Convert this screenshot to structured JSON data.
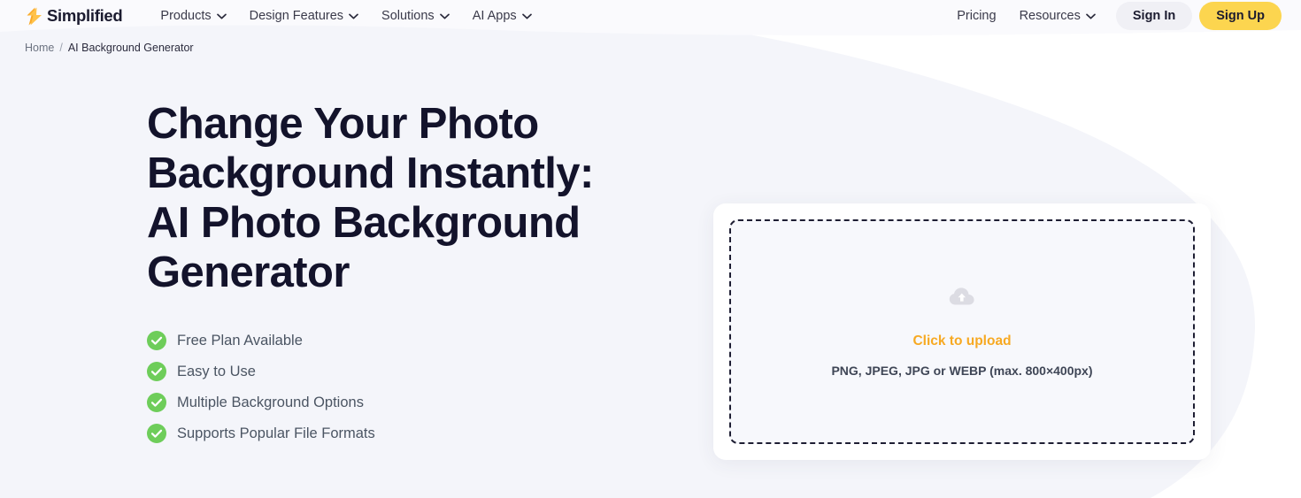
{
  "brand": {
    "name": "Simplified",
    "logo_icon": "simplified-bolt-logo"
  },
  "nav": {
    "left_items": [
      {
        "label": "Products",
        "icon": "chevron-down-icon"
      },
      {
        "label": "Design Features",
        "icon": "chevron-down-icon"
      },
      {
        "label": "Solutions",
        "icon": "chevron-down-icon"
      },
      {
        "label": "AI Apps",
        "icon": "chevron-down-icon"
      }
    ],
    "right_items": [
      {
        "label": "Pricing",
        "icon": ""
      },
      {
        "label": "Resources",
        "icon": "chevron-down-icon"
      }
    ],
    "sign_in_label": "Sign In",
    "sign_up_label": "Sign Up"
  },
  "breadcrumb": {
    "home_label": "Home",
    "separator": "/",
    "current_label": "AI Background Generator"
  },
  "hero": {
    "title": "Change Your Photo Background Instantly: AI Photo Background Generator",
    "features": [
      {
        "label": "Free Plan Available",
        "icon": "check-circle-icon"
      },
      {
        "label": "Easy to Use",
        "icon": "check-circle-icon"
      },
      {
        "label": "Multiple Background Options",
        "icon": "check-circle-icon"
      },
      {
        "label": "Supports Popular File Formats",
        "icon": "check-circle-icon"
      }
    ]
  },
  "upload": {
    "icon": "cloud-upload-icon",
    "cta_label": "Click to upload",
    "hint_label": "PNG, JPEG, JPG or WEBP (max. 800×400px)"
  },
  "colors": {
    "page_background": "#F4F5FA",
    "brand_yellow": "#FCD54F",
    "cta_orange": "#F7A922",
    "check_green": "#6ECD5A",
    "blob_violet_light": "#C77DF0",
    "blob_violet": "#9B85F5",
    "heading": "#13132B"
  }
}
